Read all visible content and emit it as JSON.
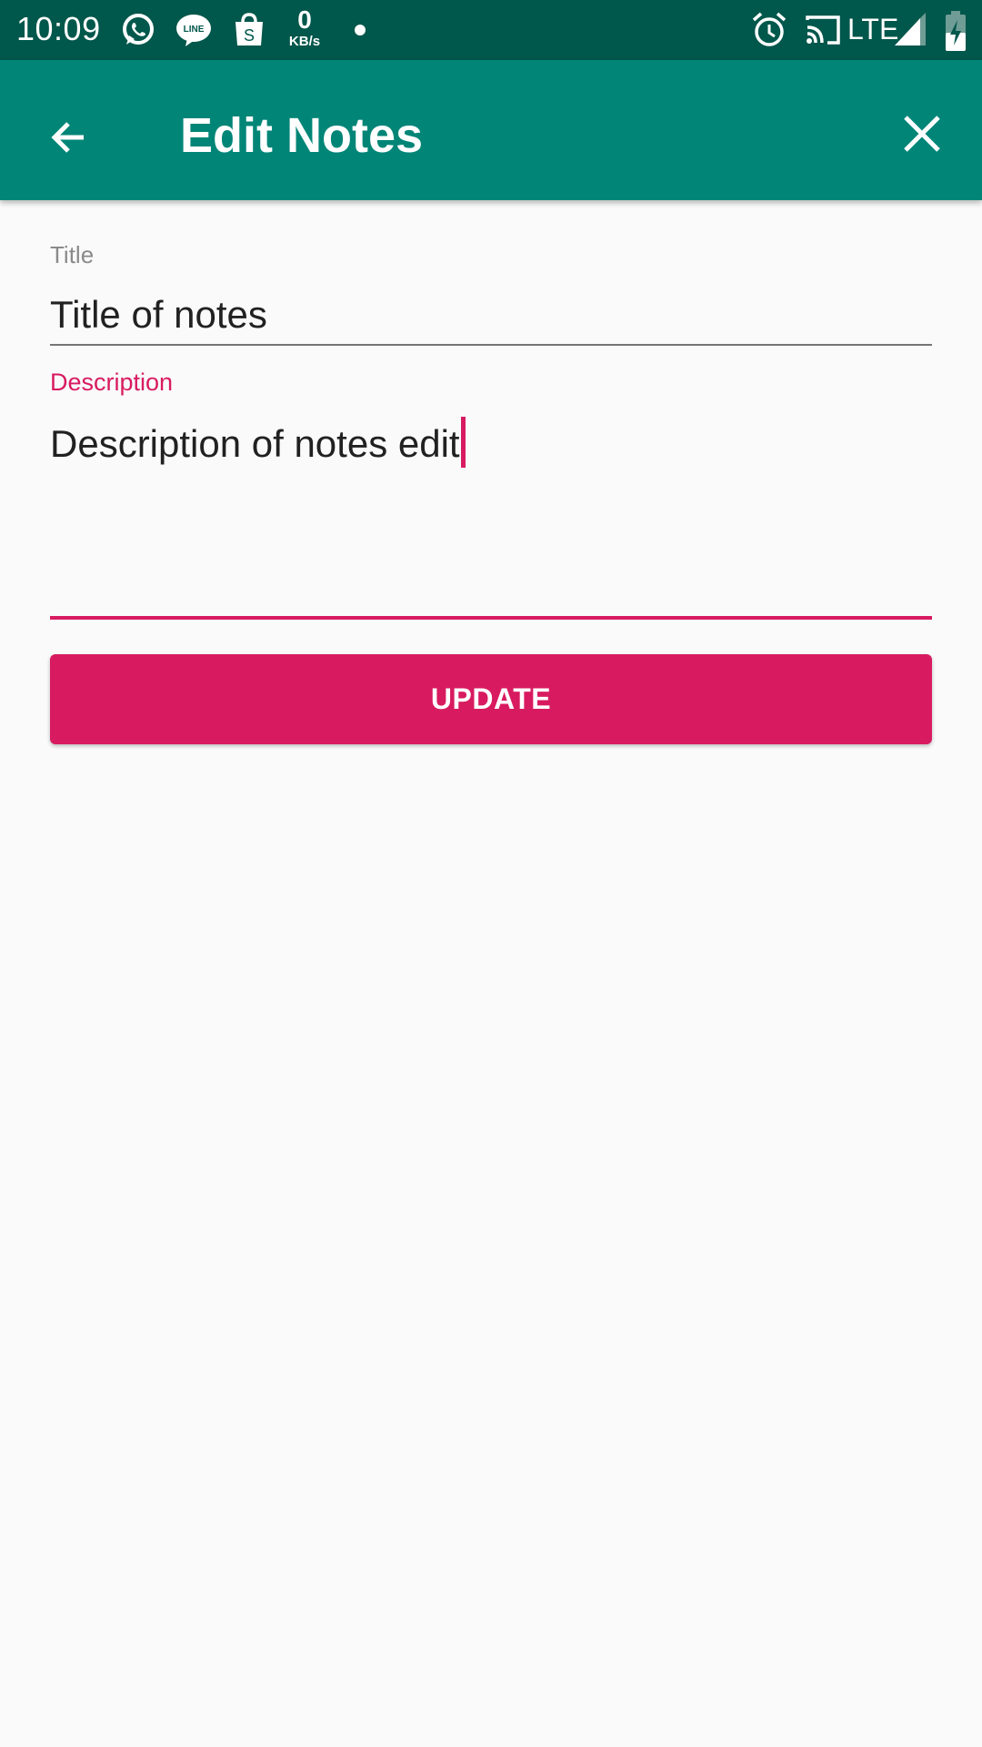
{
  "status_bar": {
    "time": "10:09",
    "net_speed_value": "0",
    "net_speed_unit": "KB/s",
    "network": "LTE",
    "icons": [
      "whatsapp-icon",
      "line-icon",
      "shopping-bag-icon",
      "alarm-icon",
      "cast-icon",
      "signal-icon",
      "battery-charging-icon"
    ]
  },
  "app_bar": {
    "title": "Edit Notes",
    "back_icon": "arrow-back-icon",
    "close_icon": "close-icon"
  },
  "form": {
    "title_label": "Title",
    "title_value": "Title of notes",
    "description_label": "Description",
    "description_value": "Description of notes edit",
    "update_label": "UPDATE"
  },
  "colors": {
    "status_bar": "#00574b",
    "app_bar": "#008577",
    "accent": "#d81b60",
    "background": "#fafafa"
  }
}
